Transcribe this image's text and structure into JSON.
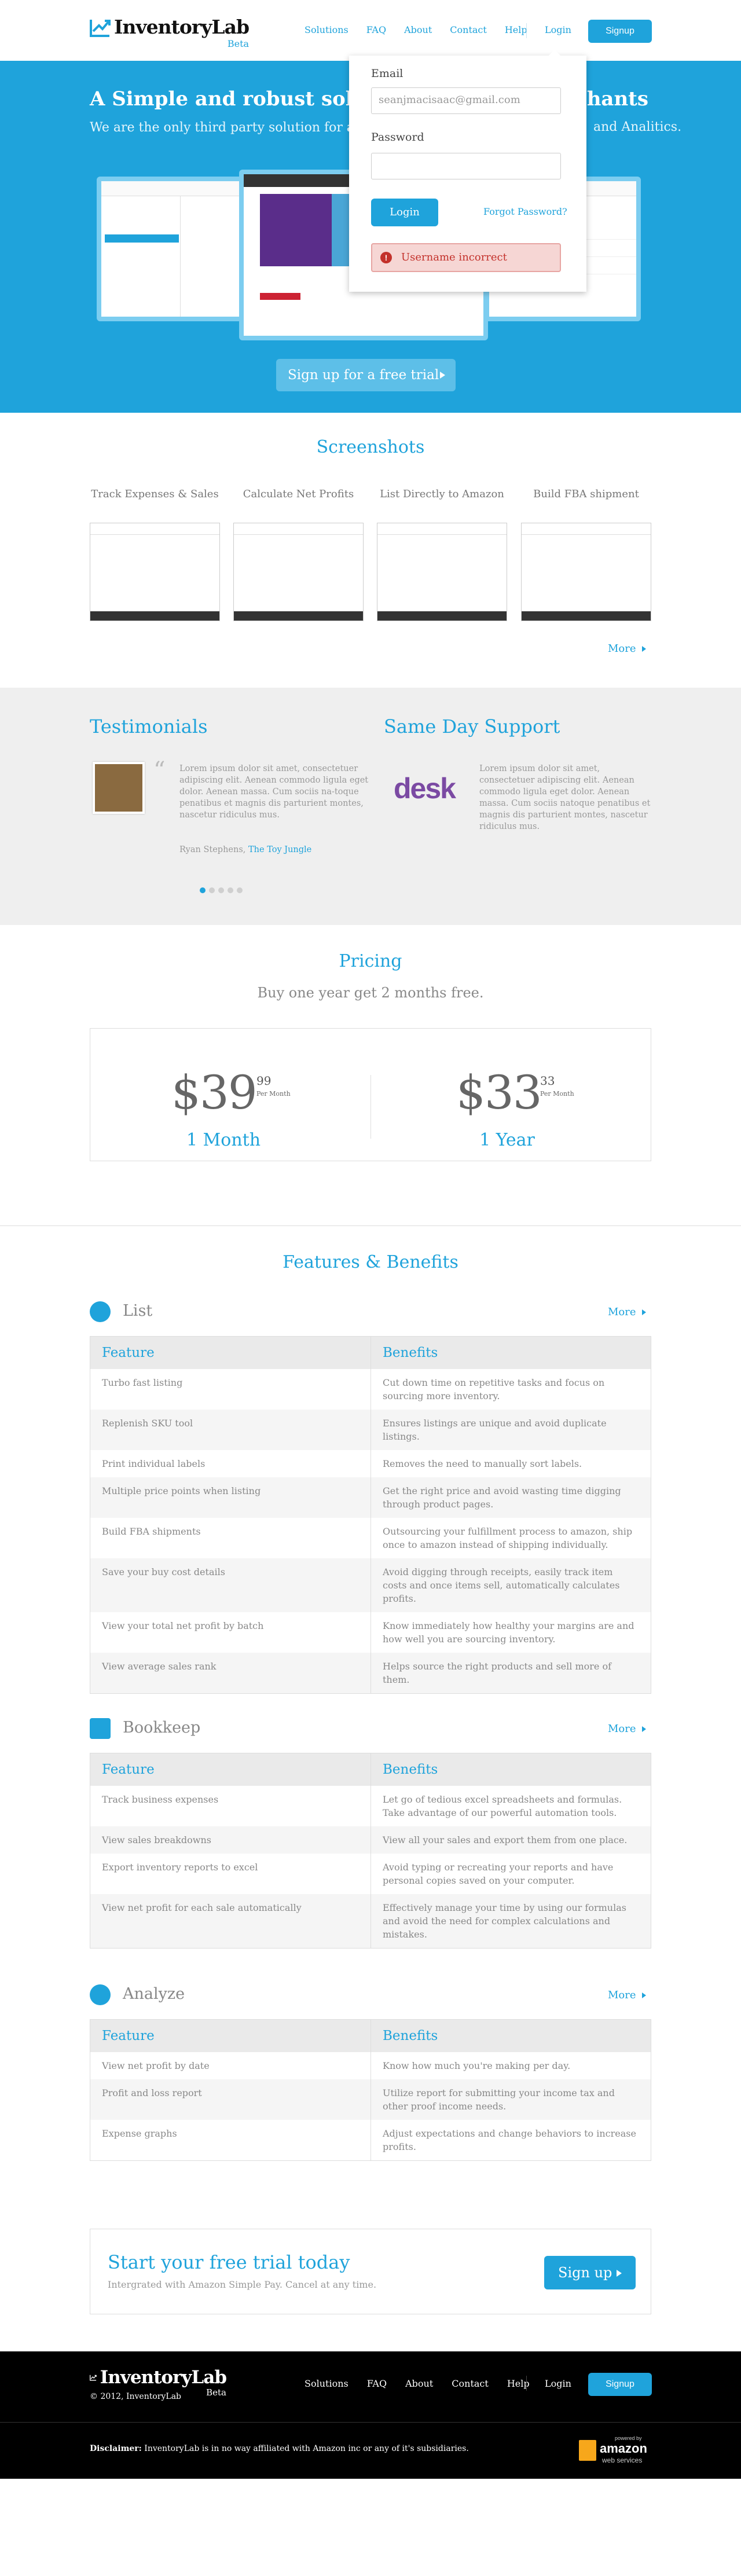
{
  "header": {
    "logo": "InventoryLab",
    "beta": "Beta",
    "nav": [
      "Solutions",
      "FAQ",
      "About",
      "Contact",
      "Help"
    ],
    "login": "Login",
    "signup": "Signup"
  },
  "hero": {
    "headline_left": "A Simple and robust solu",
    "headline_right": "chants",
    "sub_left": "We are the only third party solution for ",
    "sub_bold": "a",
    "sub_right": "and Analitics.",
    "cta": "Sign up for a free trial"
  },
  "login_dropdown": {
    "email_label": "Email",
    "email_value": "seanjmacisaac@gmail.com",
    "password_label": "Password",
    "password_value": "",
    "login_button": "Login",
    "forgot": "Forgot Password?",
    "error": "Username incorrect"
  },
  "screenshots": {
    "title": "Screenshots",
    "items": [
      "Track Expenses & Sales",
      "Calculate Net Profits",
      "List Directly to Amazon",
      "Build FBA shipment"
    ],
    "more": "More"
  },
  "testimonials": {
    "title": "Testimonials",
    "quote": "Lorem ipsum dolor sit amet, consectetuer adipiscing elit. Aenean commodo ligula eget dolor. Aenean massa. Cum sociis na-toque penatibus et magnis dis parturient montes, nascetur ridiculus mus.",
    "author": "Ryan Stephens, ",
    "company": "The Toy Jungle"
  },
  "support": {
    "title": "Same Day Support",
    "logo": "desk",
    "text": "Lorem ipsum dolor sit amet, consectetuer adipiscing elit. Aenean commodo ligula eget dolor. Aenean massa. Cum sociis natoque penatibus et magnis dis parturient montes, nascetur ridiculus mus."
  },
  "pricing": {
    "title": "Pricing",
    "subtitle": "Buy one year get 2 months free.",
    "plans": [
      {
        "price": "$39",
        "cents": "99",
        "per": "Per Month",
        "term": "1 Month"
      },
      {
        "price": "$33",
        "cents": "33",
        "per": "Per Month",
        "term": "1 Year"
      }
    ]
  },
  "features": {
    "title": "Features & Benefits",
    "col_feature": "Feature",
    "col_benefit": "Benefits",
    "more": "More",
    "sections": [
      {
        "name": "List",
        "rows": [
          [
            "Turbo fast listing",
            "Cut down time on repetitive tasks and focus on sourcing more inventory."
          ],
          [
            "Replenish SKU tool",
            "Ensures listings are unique and avoid duplicate listings."
          ],
          [
            "Print individual labels",
            "Removes the need to manually sort labels."
          ],
          [
            "Multiple price points when listing",
            "Get the right price and avoid wasting time digging through product pages."
          ],
          [
            "Build FBA shipments",
            "Outsourcing your fulfillment process to amazon, ship once to amazon instead of shipping individually."
          ],
          [
            "Save your buy cost details",
            "Avoid digging through receipts, easily track item costs and once items sell, automatically calculates profits."
          ],
          [
            "View your total net profit by batch",
            "Know immediately how healthy your margins are and how well you are sourcing inventory."
          ],
          [
            "View average sales rank",
            "Helps source the right products and sell more of them."
          ]
        ]
      },
      {
        "name": "Bookkeep",
        "rows": [
          [
            "Track business expenses",
            "Let go of tedious excel spreadsheets and formulas. Take advantage of our powerful automation tools."
          ],
          [
            "View sales breakdowns",
            "View all your sales and export them from one place."
          ],
          [
            "Export inventory reports to excel",
            "Avoid typing or recreating your reports and have personal copies saved on your computer."
          ],
          [
            "View net profit for each sale automatically",
            "Effectively manage your time by using our formulas and avoid the need for complex calculations and mistakes."
          ]
        ]
      },
      {
        "name": "Analyze",
        "rows": [
          [
            "View net profit by date",
            "Know how much you're making per day."
          ],
          [
            "Profit and loss report",
            "Utilize report for submitting your income tax and other proof income needs."
          ],
          [
            "Expense graphs",
            "Adjust expectations and change behaviors to increase profits."
          ]
        ]
      }
    ]
  },
  "trial": {
    "title": "Start your free trial today",
    "sub": "Intergrated with Amazon Simple Pay. Cancel at any time.",
    "button": "Sign up"
  },
  "footer": {
    "logo": "InventoryLab",
    "beta": "Beta",
    "copyright": "© 2012, InventoryLab",
    "nav": [
      "Solutions",
      "FAQ",
      "About",
      "Contact",
      "Help"
    ],
    "login": "Login",
    "signup": "Signup",
    "disclaimer_label": "Disclaimer:",
    "disclaimer": " InventoryLab is in no way affiliated with Amazon inc or any of it's subsidiaries.",
    "aws_powered": "powered by",
    "aws_amazon": "amazon",
    "aws_ws": "web services"
  },
  "colors": {
    "accent": "#1fa3db",
    "error": "#c3312b"
  }
}
